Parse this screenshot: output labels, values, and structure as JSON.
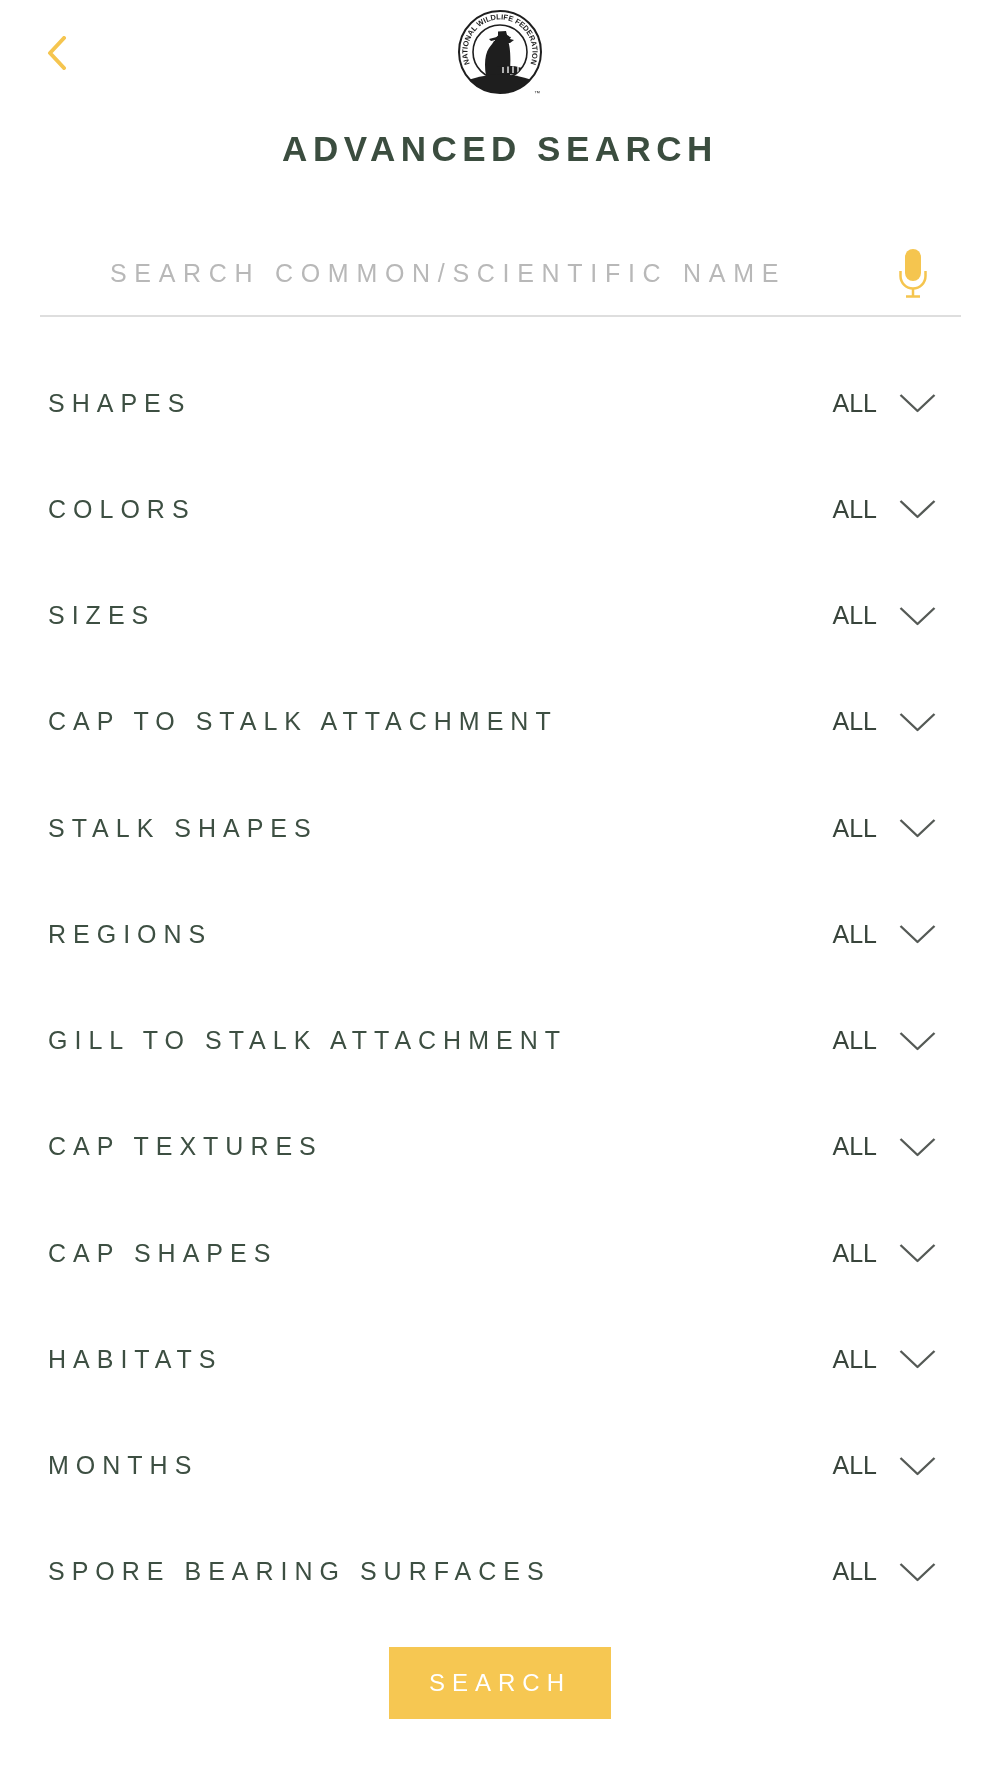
{
  "logo": {
    "ring_text": "NATIONAL WILDLIFE FEDERATION",
    "trademark": "™"
  },
  "title": "ADVANCED SEARCH",
  "search": {
    "placeholder": "SEARCH COMMON/SCIENTIFIC NAME"
  },
  "filters": [
    {
      "label": "SHAPES",
      "value": "ALL"
    },
    {
      "label": "COLORS",
      "value": "ALL"
    },
    {
      "label": "SIZES",
      "value": "ALL"
    },
    {
      "label": "CAP TO STALK ATTACHMENT",
      "value": "ALL"
    },
    {
      "label": "STALK SHAPES",
      "value": "ALL"
    },
    {
      "label": "REGIONS",
      "value": "ALL"
    },
    {
      "label": "GILL TO STALK ATTACHMENT",
      "value": "ALL"
    },
    {
      "label": "CAP TEXTURES",
      "value": "ALL"
    },
    {
      "label": "CAP SHAPES",
      "value": "ALL"
    },
    {
      "label": "HABITATS",
      "value": "ALL"
    },
    {
      "label": "MONTHS",
      "value": "ALL"
    },
    {
      "label": "SPORE BEARING SURFACES",
      "value": "ALL"
    }
  ],
  "search_button": {
    "label": "SEARCH"
  }
}
